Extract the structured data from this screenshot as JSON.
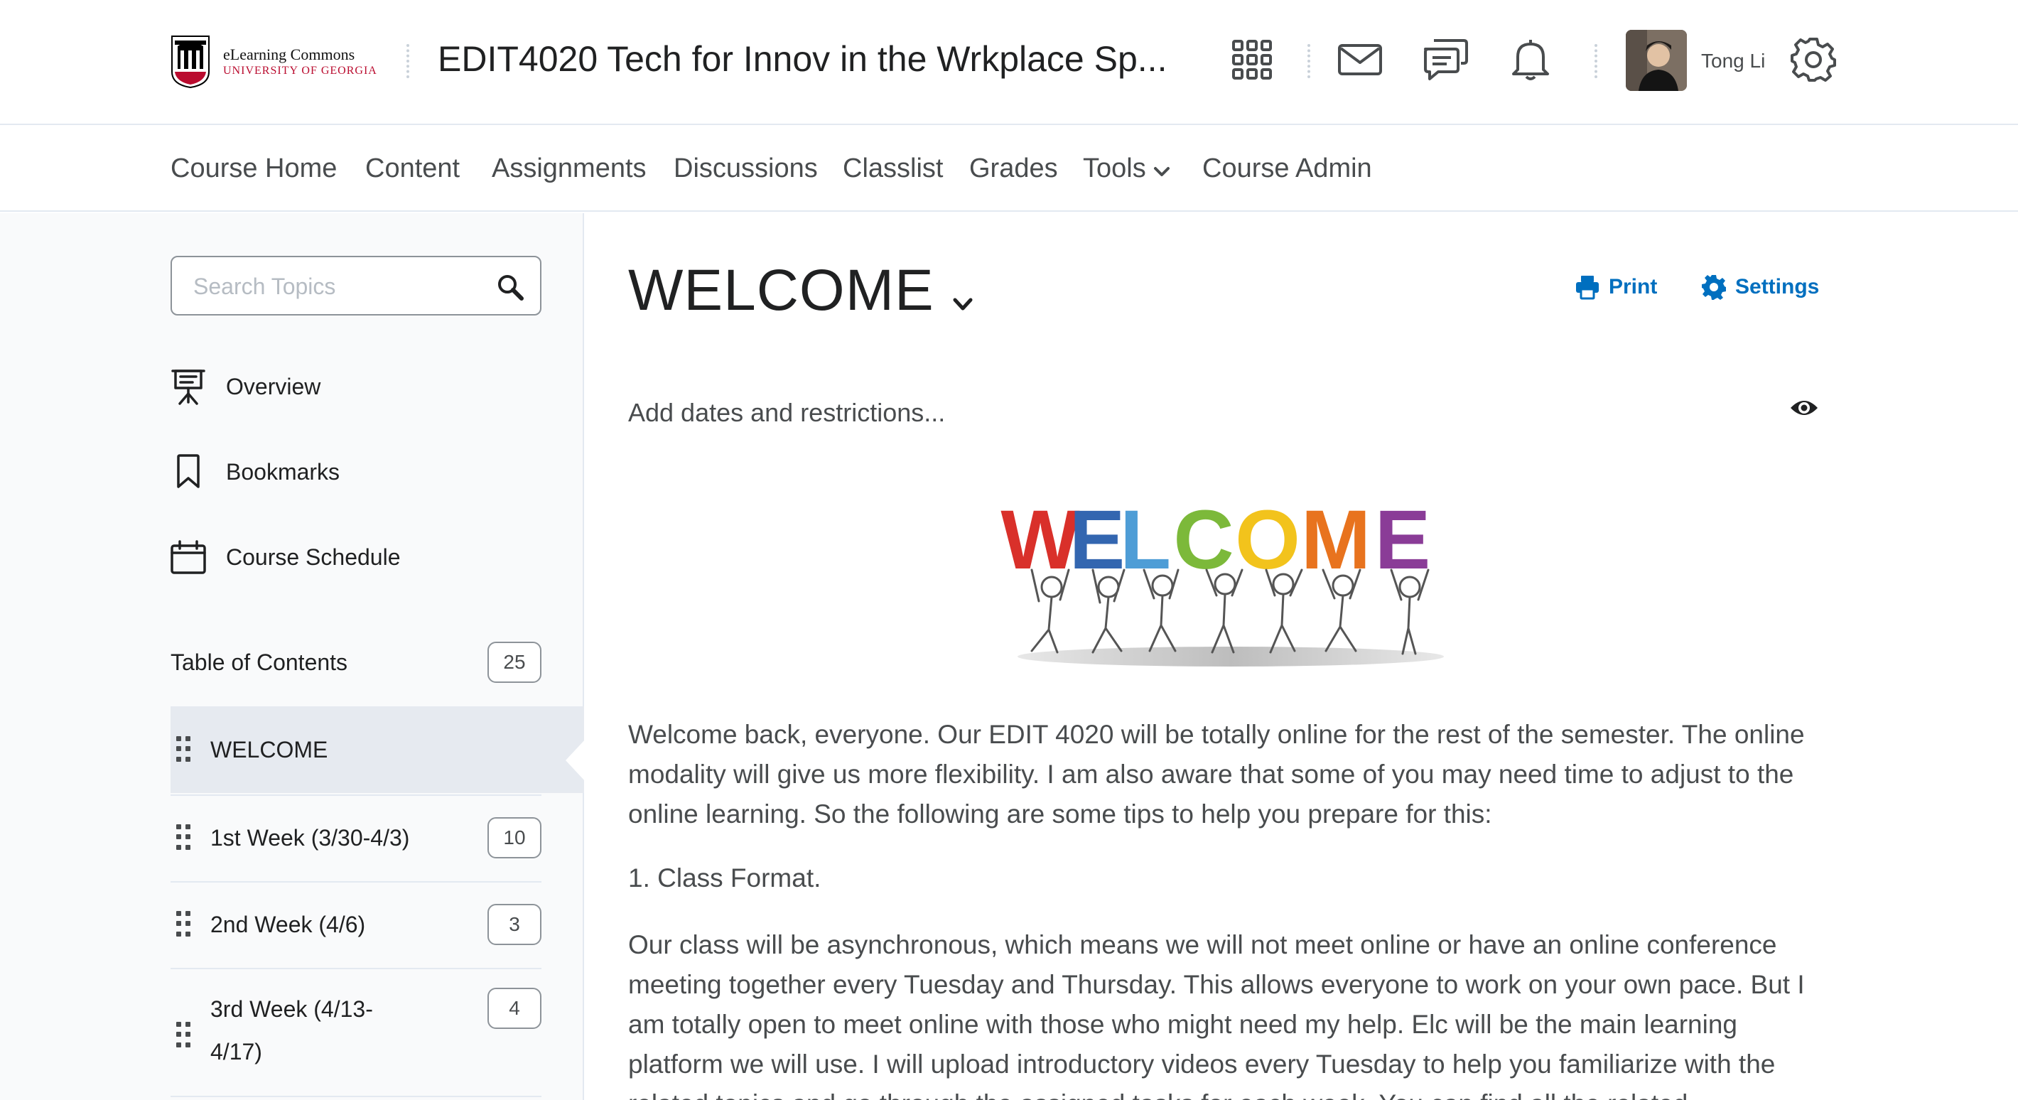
{
  "header": {
    "logo": {
      "line1": "eLearning Commons",
      "line2": "UNIVERSITY OF GEORGIA"
    },
    "course_title": "EDIT4020 Tech for Innov in the Wrkplace Sp...",
    "icons": [
      "waffle-grid-icon",
      "mail-icon",
      "chat-icon",
      "bell-icon",
      "gear-icon"
    ],
    "user_name": "Tong Li"
  },
  "nav": {
    "items": [
      "Course Home",
      "Content",
      "Assignments",
      "Discussions",
      "Classlist",
      "Grades",
      "Tools",
      "Course Admin"
    ]
  },
  "sidebar": {
    "search_placeholder": "Search Topics",
    "links": [
      {
        "label": "Overview",
        "icon": "presentation-icon"
      },
      {
        "label": "Bookmarks",
        "icon": "bookmark-icon"
      },
      {
        "label": "Course Schedule",
        "icon": "calendar-icon"
      }
    ],
    "toc": {
      "label": "Table of Contents",
      "count": "25"
    },
    "modules": [
      {
        "label": "WELCOME",
        "count": ""
      },
      {
        "label": "1st Week (3/30-4/3)",
        "count": "10"
      },
      {
        "label": "2nd Week (4/6)",
        "count": "3"
      },
      {
        "label": "3rd Week (4/13-\n4/17)",
        "count": "4"
      }
    ]
  },
  "main": {
    "title": "WELCOME",
    "print_label": "Print",
    "settings_label": "Settings",
    "restrictions_label": "Add dates and restrictions...",
    "welcome_image_text": "WELCOME",
    "paragraphs": [
      "Welcome back, everyone. Our EDIT 4020 will be totally online for the rest of the semester. The online modality will give us more flexibility. I am also aware that some of you may need time to adjust to the online learning.  So the following are some tips to help you prepare for this:",
      "1.  Class Format.",
      "Our class will be asynchronous, which means we will not meet online or have an online conference meeting together every Tuesday and Thursday. This allows everyone to work on your own pace. But I am totally open to meet online with those who might need my help.  Elc will be the main learning platform we will use. I will upload introductory videos every Tuesday to help you familiarize with the related topics and go through the assigned tasks for each week. You can find all the related"
    ]
  },
  "colors": {
    "accent": "#006fbf",
    "uga_red": "#ba0c2f",
    "text": "#202122",
    "muted": "#494c4e"
  }
}
